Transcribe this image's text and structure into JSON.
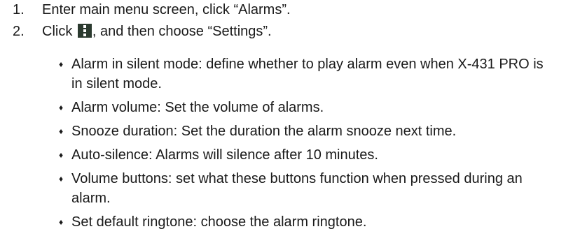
{
  "steps": [
    {
      "number": "1.",
      "text": "Enter main menu screen, click “Alarms”."
    },
    {
      "number": "2.",
      "text_before_icon": "Click ",
      "icon": "menu-dots-icon",
      "text_after_icon": ", and then choose “Settings”."
    }
  ],
  "bullet_symbol": "♦",
  "settings": [
    "Alarm in silent mode: define whether to play alarm even when X-431 PRO is in silent mode.",
    "Alarm volume: Set the volume of alarms.",
    "Snooze duration: Set the duration the alarm snooze next time.",
    "Auto-silence: Alarms will silence after 10 minutes.",
    "Volume buttons: set what these buttons function when pressed during an alarm.",
    "Set default ringtone: choose the alarm ringtone."
  ],
  "colors": {
    "text": "#1a1a1a",
    "icon_background": "#2b3a2f"
  }
}
